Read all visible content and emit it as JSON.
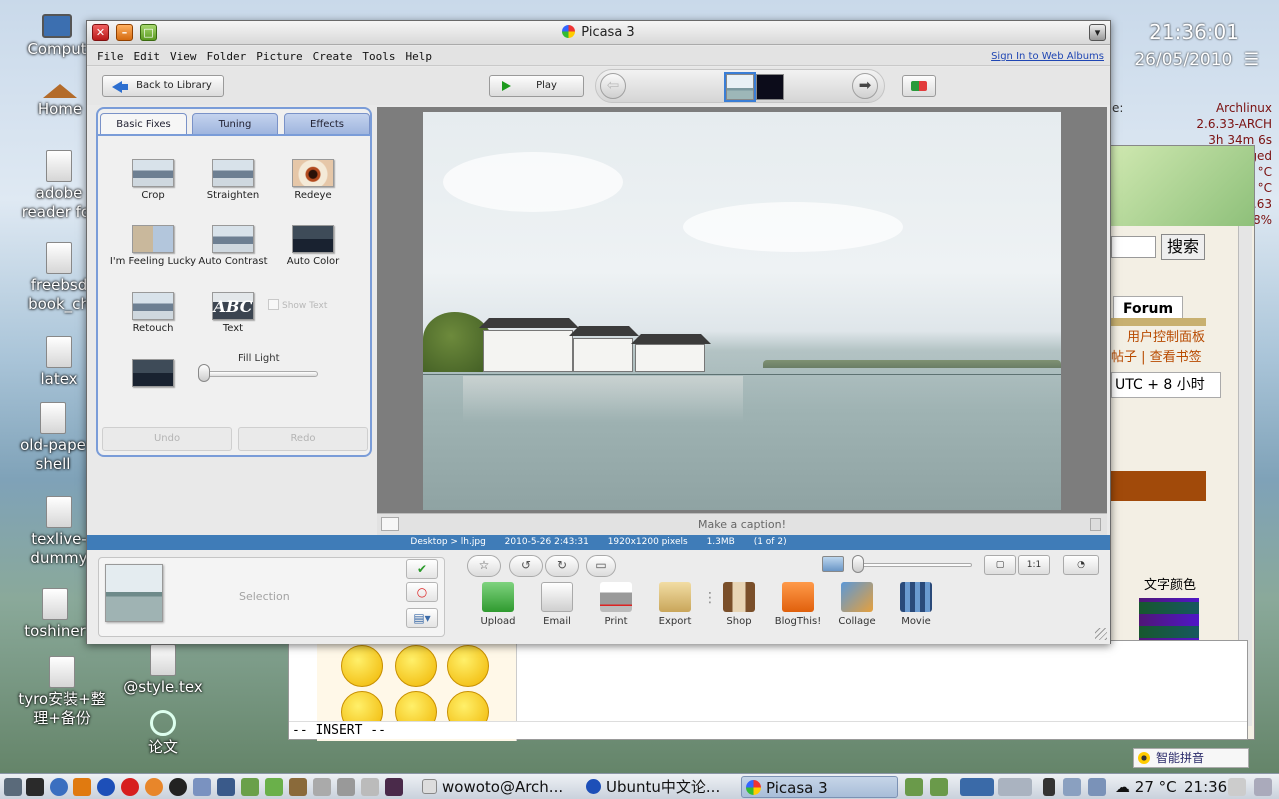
{
  "desktop": {
    "icons": [
      {
        "label": "Comput"
      },
      {
        "label": "Home"
      },
      {
        "label": "adobe reader for"
      },
      {
        "label": "freebsd book_ch"
      },
      {
        "label": "latex"
      },
      {
        "label": "old-pape shell"
      },
      {
        "label": "texlive- dummy"
      },
      {
        "label": "toshiner"
      },
      {
        "label": "tyro安装+整理+备份"
      },
      {
        "label": "@style.tex"
      },
      {
        "label": "论文"
      }
    ],
    "clock_widget": {
      "time": "21:36:01",
      "date": "26/05/2010"
    },
    "sysinfo": {
      "label": "e:",
      "lines": [
        "Archlinux",
        "2.6.33-ARCH",
        "3h 34m 6s",
        "ged",
        "°C",
        "°C",
        ".63",
        "8%"
      ]
    }
  },
  "browser_bg": {
    "search_button": "搜索",
    "forum_tab": "Forum",
    "link_control_panel": "用户控制面板",
    "link_posts": "帖子 | 查看书签",
    "timezone": "UTC + 8 小时",
    "color_label": "文字颜色"
  },
  "terminal": {
    "mode_line": "-- INSERT --"
  },
  "picasa": {
    "window_title": "Picasa 3",
    "menu": [
      "File",
      "Edit",
      "View",
      "Folder",
      "Picture",
      "Create",
      "Tools",
      "Help"
    ],
    "sign_in": "Sign In to Web Albums",
    "toolbar": {
      "back_label": "Back to Library",
      "play_label": "Play"
    },
    "tabs": [
      "Basic Fixes",
      "Tuning",
      "Effects"
    ],
    "tools": [
      {
        "label": "Crop",
        "icon": "crop-icon"
      },
      {
        "label": "Straighten",
        "icon": "straighten-icon"
      },
      {
        "label": "Redeye",
        "icon": "redeye-icon"
      },
      {
        "label": "I'm Feeling Lucky",
        "icon": "lucky-icon"
      },
      {
        "label": "Auto Contrast",
        "icon": "contrast-icon"
      },
      {
        "label": "Auto Color",
        "icon": "color-icon"
      },
      {
        "label": "Retouch",
        "icon": "retouch-icon"
      },
      {
        "label": "Text",
        "icon": "text-icon"
      }
    ],
    "text_glyph": "ABC",
    "show_text": "Show Text",
    "fill_light": {
      "label": "Fill Light",
      "level": 0
    },
    "undo_label": "Undo",
    "redo_label": "Redo",
    "caption_placeholder": "Make a caption!",
    "status": {
      "path": "Desktop > lh.jpg",
      "date": "2010-5-26 2:43:31",
      "dimensions": "1920x1200 pixels",
      "size": "1.3MB",
      "position": "(1 of 2)"
    },
    "selection_label": "Selection",
    "actions": [
      {
        "label": "Upload",
        "icon": "upload-icon",
        "color": "#3aa23a"
      },
      {
        "label": "Email",
        "icon": "email-icon",
        "color": "#dcdcdc"
      },
      {
        "label": "Print",
        "icon": "print-icon",
        "color": "#c8c8c8"
      },
      {
        "label": "Export",
        "icon": "export-icon",
        "color": "#e4c98a"
      },
      {
        "label": "Shop",
        "icon": "shop-icon",
        "color": "#d8b28a"
      },
      {
        "label": "BlogThis!",
        "icon": "blogger-icon",
        "color": "#f37a22"
      },
      {
        "label": "Collage",
        "icon": "collage-icon",
        "color": "#3a78c0"
      },
      {
        "label": "Movie",
        "icon": "movie-icon",
        "color": "#4a7ab8"
      }
    ],
    "view_one_to_one": "1:1"
  },
  "taskbar": {
    "tasks": [
      {
        "label": "wowoto@Arch..."
      },
      {
        "label": "Ubuntu中文论..."
      },
      {
        "label": "Picasa 3"
      }
    ],
    "temperature": "27 °C",
    "time": "21:36",
    "ime": "智能拼音"
  }
}
